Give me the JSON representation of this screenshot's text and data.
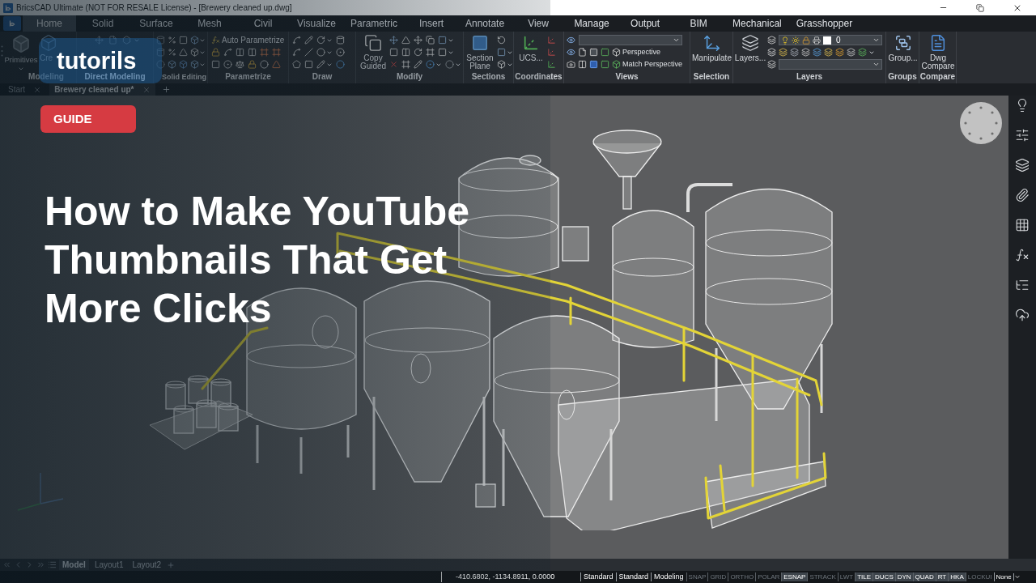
{
  "window": {
    "title": "BricsCAD Ultimate (NOT FOR RESALE License) - [Brewery cleaned up.dwg]"
  },
  "ribbon_tabs": [
    {
      "label": "Home",
      "selected": true
    },
    {
      "label": "Solid",
      "selected": false
    },
    {
      "label": "Surface",
      "selected": false
    },
    {
      "label": "Mesh",
      "selected": false
    },
    {
      "label": "Civil",
      "selected": false
    },
    {
      "label": "Visualize",
      "selected": false
    },
    {
      "label": "Parametric",
      "selected": false
    },
    {
      "label": "Insert",
      "selected": false
    },
    {
      "label": "Annotate",
      "selected": false
    },
    {
      "label": "View",
      "selected": false
    },
    {
      "label": "Manage",
      "selected": false
    },
    {
      "label": "Output",
      "selected": false
    },
    {
      "label": "BIM",
      "selected": false
    },
    {
      "label": "Mechanical",
      "selected": false
    },
    {
      "label": "Grasshopper",
      "selected": false
    }
  ],
  "ribbon_groups": [
    {
      "label": "Modeling",
      "buttons": [
        "Primitives",
        "Cre"
      ]
    },
    {
      "label": "Direct Modeling"
    },
    {
      "label": "Solid Editing"
    },
    {
      "label": "Parametrize",
      "buttons": [
        "Auto Parametrize"
      ]
    },
    {
      "label": "Draw"
    },
    {
      "label": "Modify",
      "buttons": [
        "Copy Guided"
      ]
    },
    {
      "label": "Sections",
      "buttons": [
        "Section Plane"
      ]
    },
    {
      "label": "Coordinates",
      "buttons": [
        "UCS..."
      ]
    },
    {
      "label": "Views",
      "buttons": [
        "Perspective",
        "Match Perspective"
      ]
    },
    {
      "label": "Selection",
      "buttons": [
        "Manipulate"
      ]
    },
    {
      "label": "Layers",
      "buttons": [
        "Layers..."
      ],
      "current_layer": "0"
    },
    {
      "label": "Groups",
      "buttons": [
        "Group..."
      ]
    },
    {
      "label": "Compare",
      "buttons": [
        "Dwg Compare"
      ]
    }
  ],
  "document_tabs": [
    {
      "label": "Start",
      "selected": false
    },
    {
      "label": "Brewery cleaned up*",
      "selected": true
    }
  ],
  "overlay": {
    "logo": "tutorils",
    "badge": "GUIDE",
    "headline": "How to Make YouTube Thumbnails That Get More Clicks"
  },
  "layout_tabs": [
    {
      "label": "Model",
      "selected": true
    },
    {
      "label": "Layout1",
      "selected": false
    },
    {
      "label": "Layout2",
      "selected": false
    }
  ],
  "status_bar": {
    "coordinates": "-410.6802, -1134.8911, 0.0000",
    "styles": [
      "Standard",
      "Standard",
      "Modeling"
    ],
    "toggles": [
      {
        "label": "SNAP",
        "on": false
      },
      {
        "label": "GRID",
        "on": false
      },
      {
        "label": "ORTHO",
        "on": false
      },
      {
        "label": "POLAR",
        "on": false
      },
      {
        "label": "ESNAP",
        "on": true
      },
      {
        "label": "STRACK",
        "on": false
      },
      {
        "label": "LWT",
        "on": false
      },
      {
        "label": "TILE",
        "on": true
      },
      {
        "label": "DUCS",
        "on": true
      },
      {
        "label": "DYN",
        "on": true
      },
      {
        "label": "QUAD",
        "on": true
      },
      {
        "label": "RT",
        "on": true
      },
      {
        "label": "HKA",
        "on": true
      },
      {
        "label": "LOCKUI",
        "on": false
      }
    ],
    "annotation_scale": "None"
  }
}
